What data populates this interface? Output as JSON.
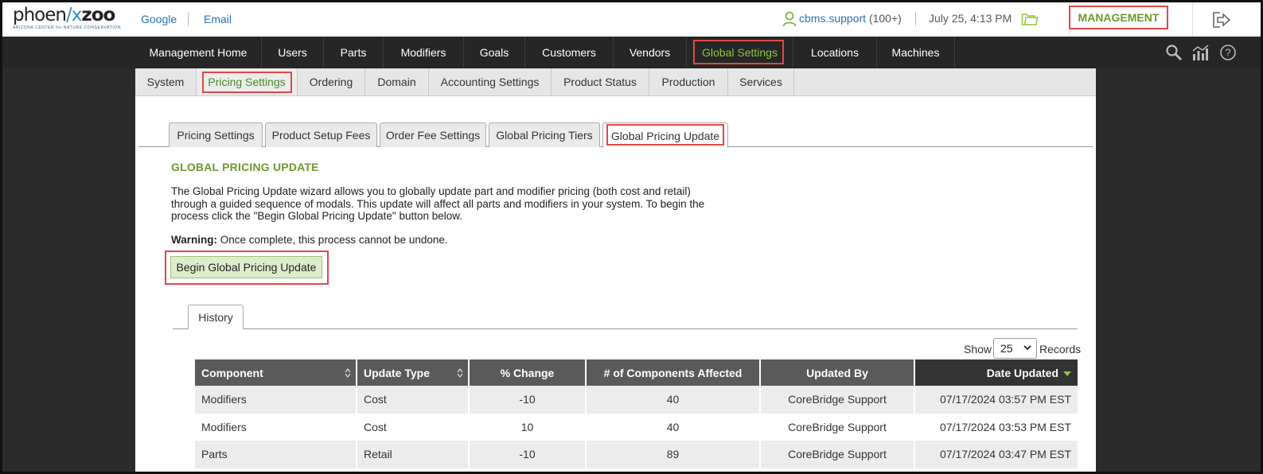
{
  "brand": {
    "logo_main_a": "phoen",
    "logo_main_b": "zoo",
    "logo_slash": "/x",
    "logo_sub": "ARIZONA CENTER for NATURE CONSERVATION"
  },
  "header": {
    "links": [
      "Google",
      "Email"
    ],
    "user_name": "cbms.support",
    "user_count": "(100+)",
    "datetime": "July 25, 4:13 PM",
    "management_label": "MANAGEMENT"
  },
  "main_nav": {
    "items": [
      "Management Home",
      "Users",
      "Parts",
      "Modifiers",
      "Goals",
      "Customers",
      "Vendors",
      "Global Settings",
      "Locations",
      "Machines"
    ],
    "active": "Global Settings"
  },
  "sub_nav": {
    "items": [
      "System",
      "Pricing Settings",
      "Ordering",
      "Domain",
      "Accounting Settings",
      "Product Status",
      "Production",
      "Services"
    ],
    "active": "Pricing Settings"
  },
  "tabs": {
    "items": [
      "Pricing Settings",
      "Product Setup Fees",
      "Order Fee Settings",
      "Global Pricing Tiers",
      "Global Pricing Update"
    ],
    "active": "Global Pricing Update"
  },
  "section": {
    "title": "GLOBAL PRICING UPDATE",
    "description": "The Global Pricing Update wizard allows you to globally update part and modifier pricing (both cost and retail) through a guided sequence of modals. This update will affect all parts and modifiers in your system. To begin the process click the \"Begin Global Pricing Update\" button below.",
    "warning_label": "Warning:",
    "warning_text": " Once complete, this process cannot be undone.",
    "begin_button": "Begin Global Pricing Update"
  },
  "history": {
    "tab_label": "History",
    "show_label": "Show",
    "show_value": "25",
    "records_label": "Records",
    "columns": [
      "Component",
      "Update Type",
      "% Change",
      "# of Components Affected",
      "Updated By",
      "Date Updated"
    ],
    "rows": [
      [
        "Modifiers",
        "Cost",
        "-10",
        "40",
        "CoreBridge Support",
        "07/17/2024 03:57 PM EST"
      ],
      [
        "Modifiers",
        "Cost",
        "10",
        "40",
        "CoreBridge Support",
        "07/17/2024 03:53 PM EST"
      ],
      [
        "Parts",
        "Retail",
        "-10",
        "89",
        "CoreBridge Support",
        "07/17/2024 03:47 PM EST"
      ]
    ]
  },
  "colors": {
    "accent_green": "#8dc63f",
    "title_green": "#6a9a30",
    "highlight_red": "#e04848",
    "nav_dark": "#262626",
    "link_blue": "#2a74b5"
  },
  "icons": [
    "user-icon",
    "folder-icon",
    "logout-icon",
    "search-icon",
    "analytics-icon",
    "help-icon",
    "sort-icon",
    "sort-desc-icon",
    "chevron-down-icon"
  ]
}
